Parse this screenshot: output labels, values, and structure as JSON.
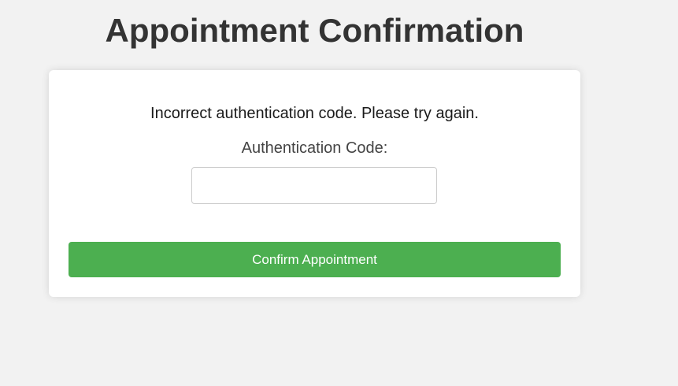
{
  "page": {
    "title": "Appointment Confirmation"
  },
  "form": {
    "error_message": "Incorrect authentication code. Please try again.",
    "code_label": "Authentication Code:",
    "code_value": "",
    "code_placeholder": "",
    "submit_label": "Confirm Appointment"
  },
  "colors": {
    "background": "#f2f2f2",
    "card": "#ffffff",
    "title": "#333333",
    "button": "#4caf50",
    "button_text": "#ffffff"
  }
}
